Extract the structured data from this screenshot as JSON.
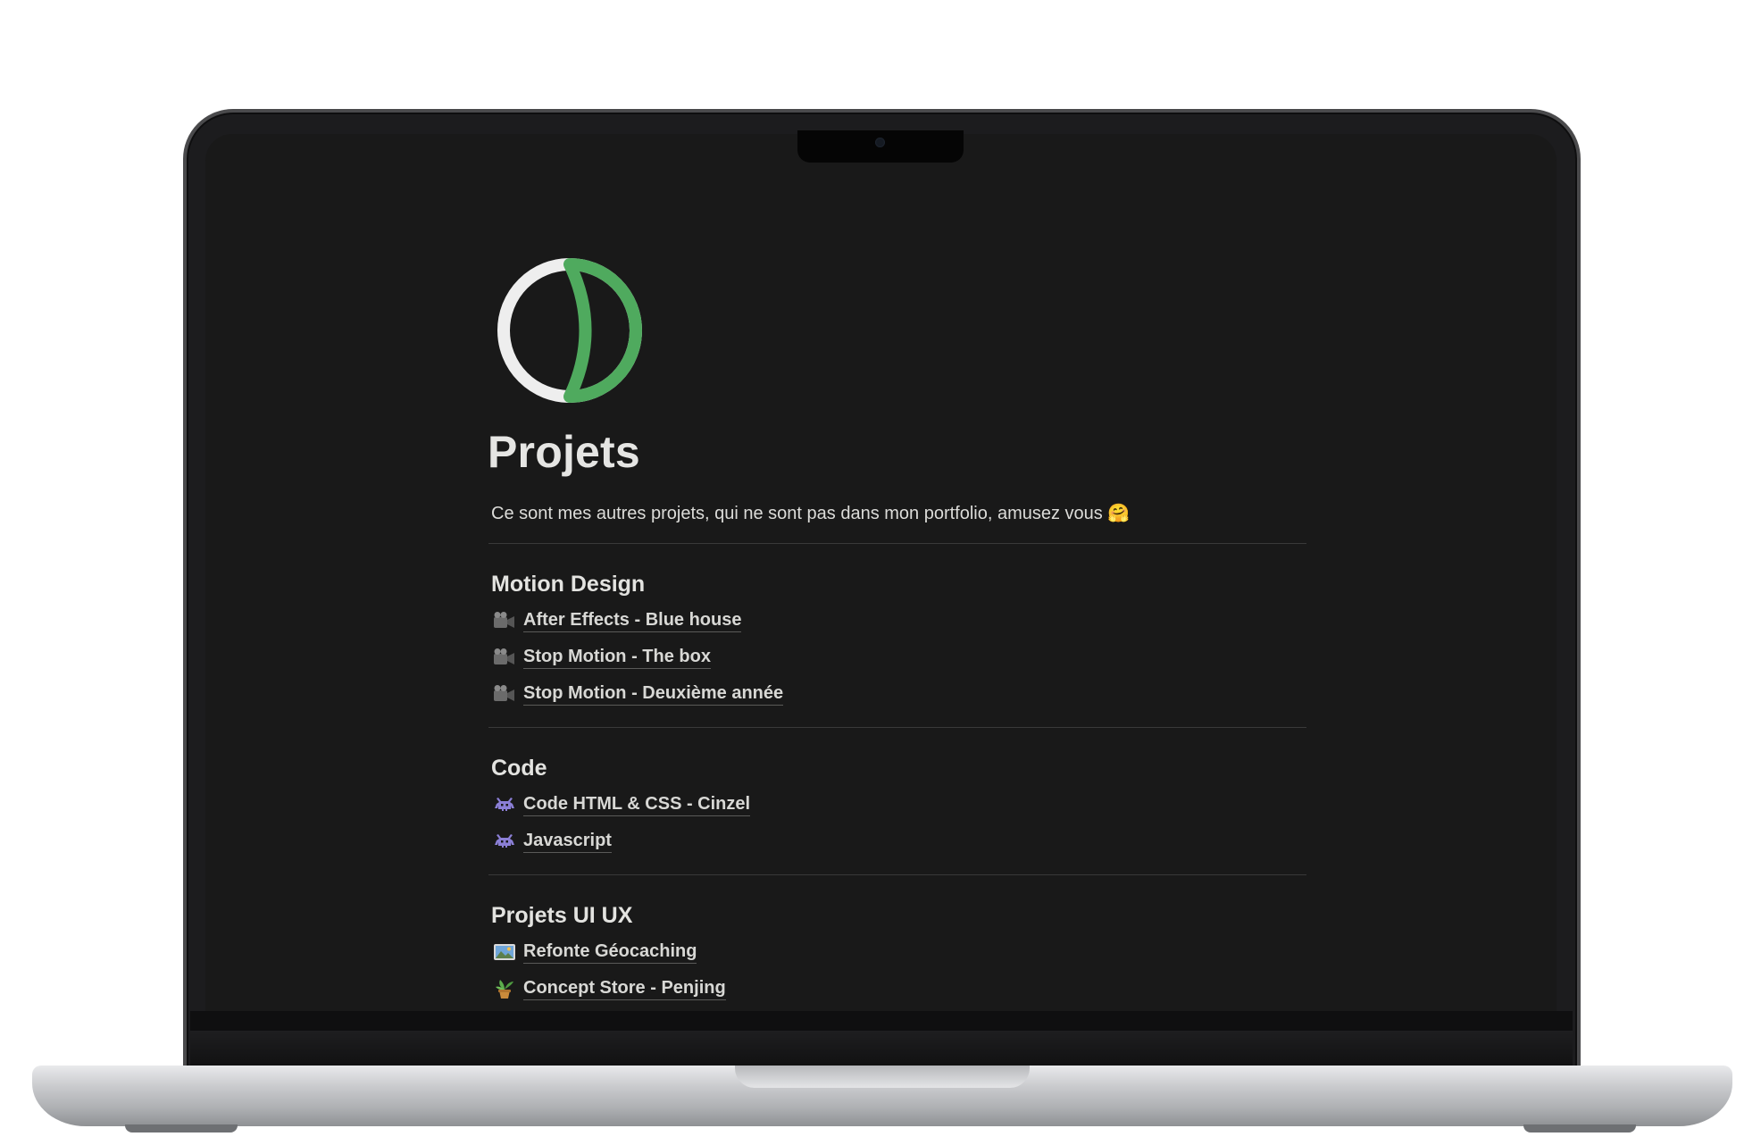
{
  "page": {
    "title": "Projets",
    "intro": "Ce sont mes autres projets, qui ne sont pas dans mon portfolio, amusez vous 🤗",
    "icon": "green-half-moon-logo"
  },
  "sections": [
    {
      "title": "Motion Design",
      "items": [
        {
          "icon": "video-camera-icon",
          "label": "After Effects - Blue house"
        },
        {
          "icon": "video-camera-icon",
          "label": "Stop Motion - The box"
        },
        {
          "icon": "video-camera-icon",
          "label": "Stop Motion - Deuxième année"
        }
      ]
    },
    {
      "title": "Code",
      "items": [
        {
          "icon": "alien-monster-icon",
          "label": "Code HTML & CSS - Cinzel"
        },
        {
          "icon": "alien-monster-icon",
          "label": "Javascript"
        }
      ]
    },
    {
      "title": "Projets UI UX",
      "items": [
        {
          "icon": "map-picture-icon",
          "label": "Refonte Géocaching"
        },
        {
          "icon": "potted-plant-icon",
          "label": "Concept Store - Penjing"
        }
      ]
    }
  ],
  "colors": {
    "background": "#191919",
    "text": "#e5e5e3",
    "accent": "#4faa5e",
    "divider": "#393939"
  }
}
